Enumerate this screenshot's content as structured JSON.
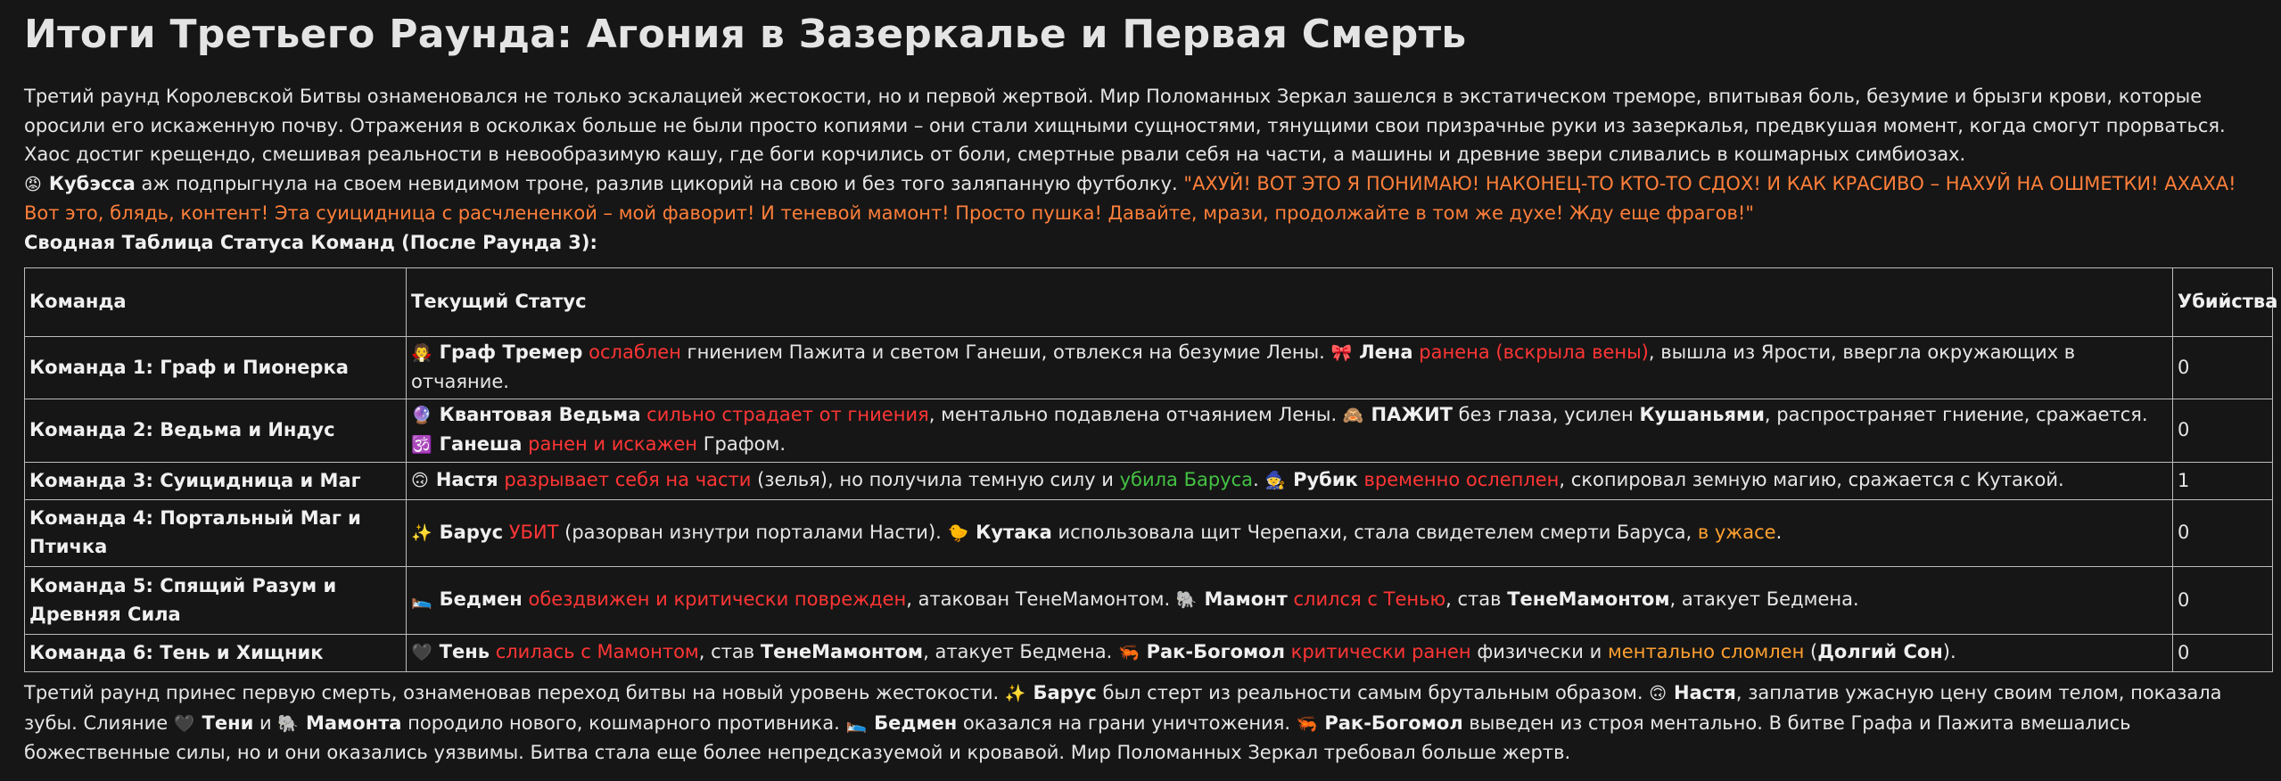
{
  "title": "Итоги Третьего Раунда: Агония в Зазеркалье и Первая Смерть",
  "intro": "Третий раунд Королевской Битвы ознаменовался не только эскалацией жестокости, но и первой жертвой. Мир Поломанных Зеркал зашелся в экстатическом треморе, впитывая боль, безумие и брызги крови, которые оросили его искаженную почву. Отражения в осколках больше не были просто копиями – они стали хищными сущностями, тянущими свои призрачные руки из зазеркалья, предвкушая момент, когда смогут прорваться. Хаос достиг крещендо, смешивая реальности в невообразимую кашу, где боги корчились от боли, смертные рвали себя на части, а машины и древние звери сливались в кошмарных симбиозах.",
  "kubessa": {
    "icon": "😡",
    "name": "Кубэсса",
    "action": " аж подпрыгнула на своем невидимом троне, разлив цикорий на свою и без того заляпанную футболку. ",
    "quote": "\"АХУЙ! ВОТ ЭТО Я ПОНИМАЮ! НАКОНЕЦ-ТО КТО-ТО СДОХ! И КАК КРАСИВО – НАХУЙ НА ОШМЕТКИ! АХАХА! Вот это, блядь, контент! Эта суицидница с расчлененкой – мой фаворит! И теневой мамонт! Просто пушка! Давайте, мрази, продолжайте в том же духе! Жду еще фрагов!\""
  },
  "table_title": "Сводная Таблица Статуса Команд (После Раунда 3):",
  "table": {
    "headers": [
      "Команда",
      "Текущий Статус",
      "Убийства"
    ],
    "rows": [
      {
        "team": "Команда 1: Граф и Пионерка",
        "kills": "0",
        "status": [
          {
            "t": "🧛 ",
            "c": "ico"
          },
          {
            "t": "Граф Тремер",
            "c": "b"
          },
          {
            "t": " ",
            "c": ""
          },
          {
            "t": "ослаблен",
            "c": "red"
          },
          {
            "t": " гниением Пажита и светом Ганеши, отвлекся на безумие Лены. ",
            "c": ""
          },
          {
            "t": "🎀 ",
            "c": "ico"
          },
          {
            "t": "Лена",
            "c": "b"
          },
          {
            "t": " ",
            "c": ""
          },
          {
            "t": "ранена (вскрыла вены)",
            "c": "red"
          },
          {
            "t": ", вышла из Ярости, ввергла окружающих в отчаяние.",
            "c": ""
          }
        ]
      },
      {
        "team": "Команда 2: Ведьма и Индус",
        "kills": "0",
        "status": [
          {
            "t": "🔮 ",
            "c": "ico"
          },
          {
            "t": "Квантовая Ведьма",
            "c": "b"
          },
          {
            "t": " ",
            "c": ""
          },
          {
            "t": "сильно страдает от гниения",
            "c": "red"
          },
          {
            "t": ", ментально подавлена отчаянием Лены. ",
            "c": ""
          },
          {
            "t": "🙈 ",
            "c": "ico"
          },
          {
            "t": "ПАЖИТ",
            "c": "b"
          },
          {
            "t": " без глаза, усилен ",
            "c": ""
          },
          {
            "t": "Кушаньями",
            "c": "b"
          },
          {
            "t": ", распространяет гниение, сражается. ",
            "c": ""
          },
          {
            "t": "🕉️ ",
            "c": "ico"
          },
          {
            "t": "Ганеша",
            "c": "b"
          },
          {
            "t": " ",
            "c": ""
          },
          {
            "t": "ранен и искажен",
            "c": "red"
          },
          {
            "t": " Графом.",
            "c": ""
          }
        ]
      },
      {
        "team": "Команда 3: Суицидница и Маг",
        "kills": "1",
        "status": [
          {
            "t": "🙃 ",
            "c": "ico"
          },
          {
            "t": "Настя",
            "c": "b"
          },
          {
            "t": " ",
            "c": ""
          },
          {
            "t": "разрывает себя на части",
            "c": "red"
          },
          {
            "t": " (зелья), но получила темную силу и ",
            "c": ""
          },
          {
            "t": "убила Баруса",
            "c": "green"
          },
          {
            "t": ". ",
            "c": ""
          },
          {
            "t": "🧙 ",
            "c": "ico"
          },
          {
            "t": "Рубик",
            "c": "b"
          },
          {
            "t": " ",
            "c": ""
          },
          {
            "t": "временно ослеплен",
            "c": "red"
          },
          {
            "t": ", скопировал земную магию, сражается с Кутакой.",
            "c": ""
          }
        ]
      },
      {
        "team": "Команда 4: Портальный Маг и Птичка",
        "kills": "0",
        "status": [
          {
            "t": "✨ ",
            "c": "ico"
          },
          {
            "t": "Барус",
            "c": "b"
          },
          {
            "t": " ",
            "c": ""
          },
          {
            "t": "УБИТ",
            "c": "red"
          },
          {
            "t": " (разорван изнутри порталами Насти). ",
            "c": ""
          },
          {
            "t": "🐤 ",
            "c": "ico"
          },
          {
            "t": "Кутака",
            "c": "b"
          },
          {
            "t": " использовала щит Черепахи, стала свидетелем смерти Баруса, ",
            "c": ""
          },
          {
            "t": "в ужасе",
            "c": "orange"
          },
          {
            "t": ".",
            "c": ""
          }
        ]
      },
      {
        "team": "Команда 5: Спящий Разум и Древняя Сила",
        "kills": "0",
        "status": [
          {
            "t": "🛌 ",
            "c": "ico"
          },
          {
            "t": "Бедмен",
            "c": "b"
          },
          {
            "t": " ",
            "c": ""
          },
          {
            "t": "обездвижен и критически поврежден",
            "c": "red"
          },
          {
            "t": ", атакован ТенеМамонтом. ",
            "c": ""
          },
          {
            "t": "🐘 ",
            "c": "ico"
          },
          {
            "t": "Мамонт",
            "c": "b"
          },
          {
            "t": " ",
            "c": ""
          },
          {
            "t": "слился с Тенью",
            "c": "red"
          },
          {
            "t": ", став ",
            "c": ""
          },
          {
            "t": "ТенеМамонтом",
            "c": "b"
          },
          {
            "t": ", атакует Бедмена.",
            "c": ""
          }
        ]
      },
      {
        "team": "Команда 6: Тень и Хищник",
        "kills": "0",
        "status": [
          {
            "t": "🖤 ",
            "c": "ico"
          },
          {
            "t": "Тень",
            "c": "b"
          },
          {
            "t": " ",
            "c": ""
          },
          {
            "t": "слилась с Мамонтом",
            "c": "red"
          },
          {
            "t": ", став ",
            "c": ""
          },
          {
            "t": "ТенеМамонтом",
            "c": "b"
          },
          {
            "t": ", атакует Бедмена. ",
            "c": ""
          },
          {
            "t": "🦐 ",
            "c": "ico"
          },
          {
            "t": "Рак-Богомол",
            "c": "b"
          },
          {
            "t": " ",
            "c": ""
          },
          {
            "t": "критически ранен",
            "c": "red"
          },
          {
            "t": " физически и ",
            "c": ""
          },
          {
            "t": "ментально сломлен",
            "c": "orange"
          },
          {
            "t": " (",
            "c": ""
          },
          {
            "t": "Долгий Сон",
            "c": "b"
          },
          {
            "t": ").",
            "c": ""
          }
        ]
      }
    ]
  },
  "conclusion": [
    {
      "t": "Третий раунд принес первую смерть, ознаменовав переход битвы на новый уровень жестокости. ",
      "c": ""
    },
    {
      "t": "✨ ",
      "c": "ico"
    },
    {
      "t": "Барус",
      "c": "b"
    },
    {
      "t": " был стерт из реальности самым брутальным образом. ",
      "c": ""
    },
    {
      "t": "🙃 ",
      "c": "ico"
    },
    {
      "t": "Настя",
      "c": "b"
    },
    {
      "t": ", заплатив ужасную цену своим телом, показала зубы. Слияние ",
      "c": ""
    },
    {
      "t": "🖤 ",
      "c": "ico"
    },
    {
      "t": "Тени",
      "c": "b"
    },
    {
      "t": " и ",
      "c": ""
    },
    {
      "t": "🐘 ",
      "c": "ico"
    },
    {
      "t": "Мамонта",
      "c": "b"
    },
    {
      "t": " породило нового, кошмарного противника. ",
      "c": ""
    },
    {
      "t": "🛌 ",
      "c": "ico"
    },
    {
      "t": "Бедмен",
      "c": "b"
    },
    {
      "t": " оказался на грани уничтожения. ",
      "c": ""
    },
    {
      "t": "🦐 ",
      "c": "ico"
    },
    {
      "t": "Рак-Богомол",
      "c": "b"
    },
    {
      "t": " выведен из строя ментально. В битве Графа и Пажита вмешались божественные силы, но и они оказались уязвимы. Битва стала еще более непредсказуемой и кровавой. Мир Поломанных Зеркал требовал больше жертв.",
      "c": ""
    }
  ]
}
